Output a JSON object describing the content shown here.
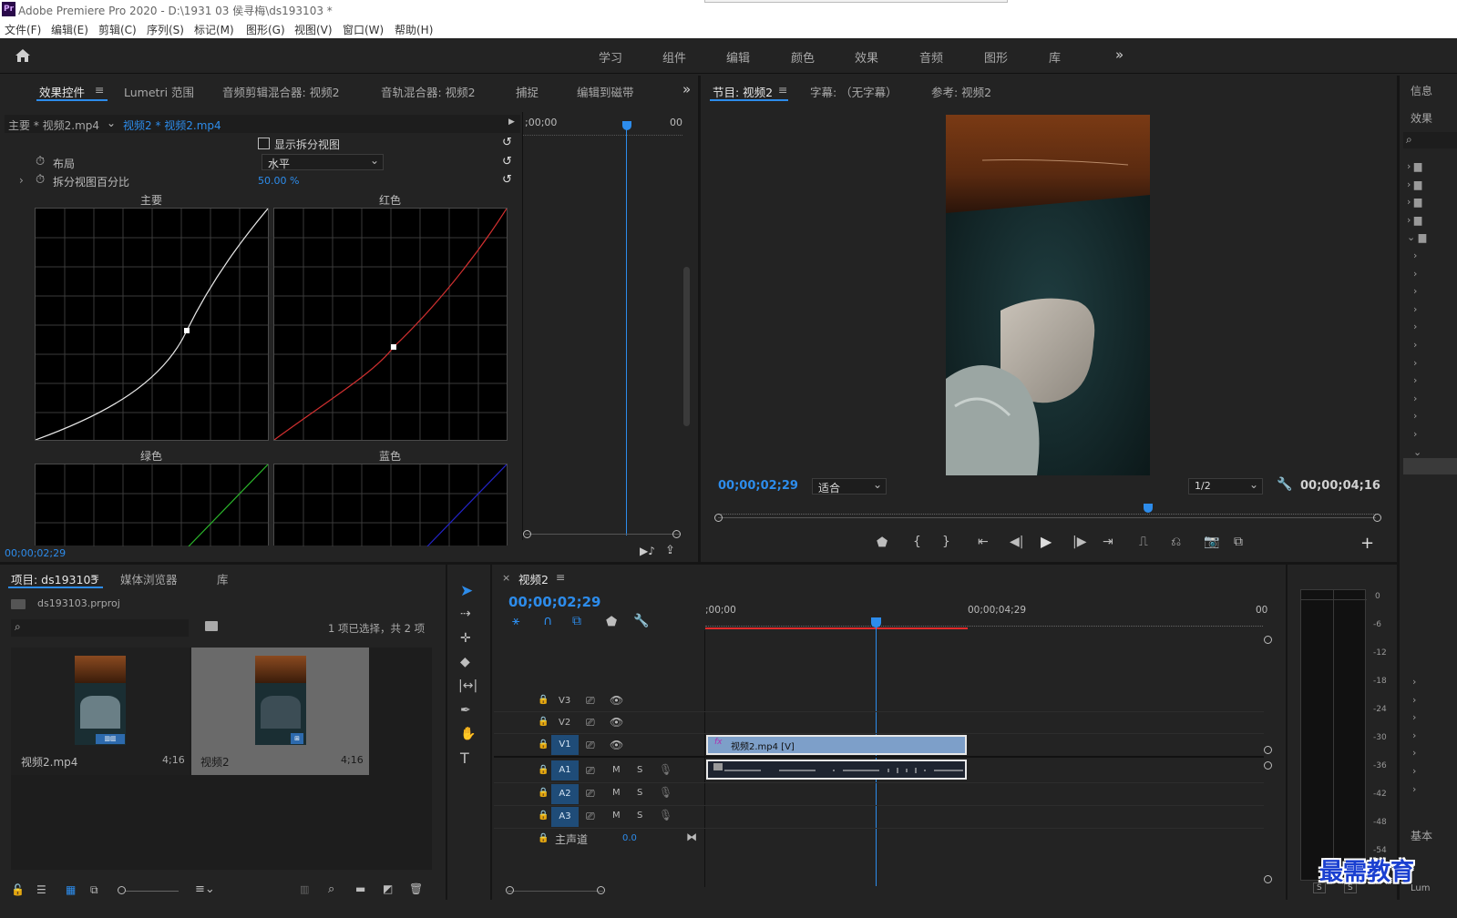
{
  "app": {
    "icon_text": "Pr",
    "title": "Adobe Premiere Pro 2020 - D:\\1931 03 侯寻梅\\ds193103 *"
  },
  "menu": [
    "文件(F)",
    "编辑(E)",
    "剪辑(C)",
    "序列(S)",
    "标记(M)",
    "图形(G)",
    "视图(V)",
    "窗口(W)",
    "帮助(H)"
  ],
  "workspaces": [
    "学习",
    "组件",
    "编辑",
    "颜色",
    "效果",
    "音频",
    "图形",
    "库"
  ],
  "effect_panel": {
    "tabs": [
      "效果控件",
      "Lumetri 范围",
      "音频剪辑混合器: 视频2",
      "音轨混合器: 视频2",
      "捕捉",
      "编辑到磁带"
    ],
    "clip_master": "主要 * 视频2.mp4",
    "clip_seq": "视频2 * 视频2.mp4",
    "split_view_label": "显示拆分视图",
    "layout_label": "布局",
    "layout_value": "水平",
    "split_pct_label": "拆分视图百分比",
    "split_pct_value": "50.00 %",
    "curves": [
      "主要",
      "红色",
      "绿色",
      "蓝色"
    ],
    "ruler_start": ";00;00",
    "ruler_end": "00",
    "timecode": "00;00;02;29"
  },
  "program": {
    "tabs": [
      "节目: 视频2",
      "字幕: （无字幕）",
      "参考: 视频2"
    ],
    "timecode": "00;00;02;29",
    "fit": "适合",
    "resolution": "1/2",
    "duration": "00;00;04;16"
  },
  "right_panel": {
    "tab1": "信息",
    "tab2": "效果",
    "bottom": "基本",
    "bottom2": "Lum"
  },
  "project": {
    "tabs": [
      "项目: ds193103",
      "媒体浏览器",
      "库"
    ],
    "file": "ds193103.prproj",
    "selection": "1 项已选择，共 2 项",
    "items": [
      {
        "name": "视频2.mp4",
        "duration": "4;16"
      },
      {
        "name": "视频2",
        "duration": "4;16"
      }
    ]
  },
  "timeline": {
    "sequence": "视频2",
    "timecode": "00;00;02;29",
    "ruler": [
      ";00;00",
      "00;00;04;29",
      "00"
    ],
    "video_tracks": [
      "V3",
      "V2",
      "V1"
    ],
    "audio_tracks": [
      "A1",
      "A2",
      "A3"
    ],
    "mute": "M",
    "solo": "S",
    "master_label": "主声道",
    "master_value": "0.0",
    "clip_label": "视频2.mp4 [V]",
    "fx": "fx"
  },
  "meter": {
    "scale": [
      "0",
      "-6",
      "-12",
      "-18",
      "-24",
      "-30",
      "-36",
      "-42",
      "-48",
      "-54"
    ],
    "s1": "S",
    "s2": "S"
  },
  "watermark": "最需教育",
  "colors": {
    "accent": "#2d8ceb",
    "red_bar": "#e02b2b",
    "clip_video": "#7d9fc9"
  }
}
